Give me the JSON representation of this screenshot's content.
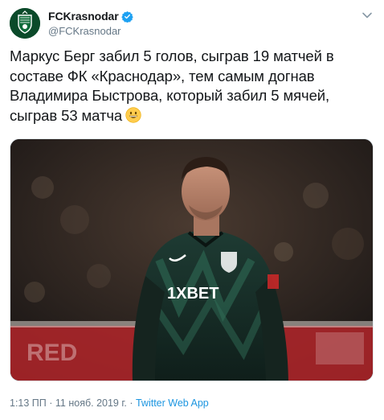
{
  "account": {
    "display_name": "FCKrasnodar",
    "handle": "@FCKrasnodar",
    "verified": true,
    "avatar_icon": "fc-krasnodar-crest-icon"
  },
  "tweet": {
    "text": "Маркус Берг забил 5 голов, сыграв 19 матчей в составе ФК «Краснодар», тем самым догнав Владимира Быстрова, который забил 5 мячей, сыграв 53 матча",
    "emoji": "grinning-face-icon",
    "media": {
      "shirt_sponsor": "1XBET",
      "advertising_board": "RED"
    }
  },
  "meta": {
    "time": "1:13 ПП",
    "separator": " · ",
    "date": "11 нояб. 2019 г.",
    "source": "Twitter Web App"
  },
  "colors": {
    "text": "#14171a",
    "secondary": "#657786",
    "link": "#1b95e0",
    "verified": "#1da1f2",
    "club_green": "#0b4a2a"
  }
}
